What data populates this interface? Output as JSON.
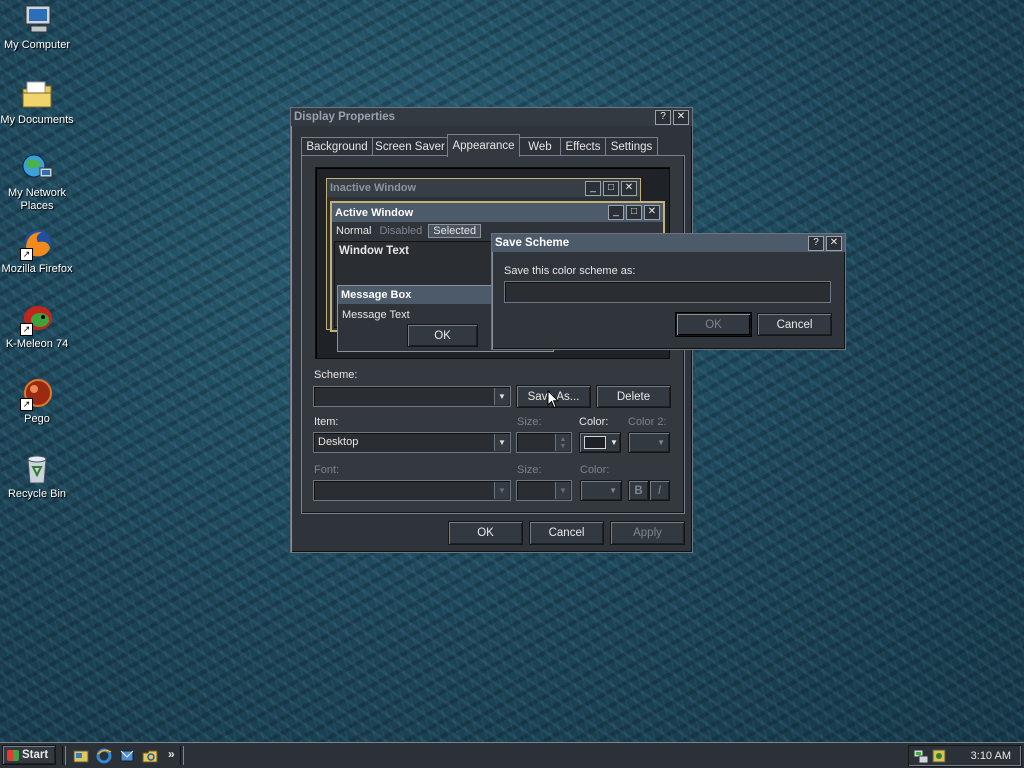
{
  "desktop_icons": [
    {
      "label": "My Computer",
      "icon": "computer-icon"
    },
    {
      "label": "My Documents",
      "icon": "folder-icon"
    },
    {
      "label": "My Network Places",
      "icon": "network-icon"
    },
    {
      "label": "Mozilla Firefox",
      "icon": "firefox-icon"
    },
    {
      "label": "K-Meleon 74",
      "icon": "kmeleon-icon"
    },
    {
      "label": "Pego",
      "icon": "pego-icon"
    },
    {
      "label": "Recycle Bin",
      "icon": "recycle-bin-icon"
    }
  ],
  "display_properties": {
    "title": "Display Properties",
    "tabs": [
      "Background",
      "Screen Saver",
      "Appearance",
      "Web",
      "Effects",
      "Settings"
    ],
    "active_tab": "Appearance",
    "preview": {
      "inactive_title": "Inactive Window",
      "active_title": "Active Window",
      "menu": [
        "Normal",
        "Disabled",
        "Selected"
      ],
      "window_text": "Window Text",
      "message_box_title": "Message Box",
      "message_text": "Message Text",
      "ok_label": "OK"
    },
    "scheme_label": "Scheme:",
    "scheme_value": "",
    "save_as_label": "Save As...",
    "delete_label": "Delete",
    "item_label": "Item:",
    "item_value": "Desktop",
    "size_label": "Size:",
    "color_label": "Color:",
    "color2_label": "Color 2:",
    "font_label": "Font:",
    "font_size_label": "Size:",
    "font_color_label": "Color:",
    "bold_label": "B",
    "italic_label": "I",
    "ok": "OK",
    "cancel": "Cancel",
    "apply": "Apply"
  },
  "save_scheme": {
    "title": "Save Scheme",
    "prompt": "Save this color scheme as:",
    "input_value": "",
    "ok": "OK",
    "cancel": "Cancel"
  },
  "taskbar": {
    "start_label": "Start",
    "quick_launch": [
      "show-desktop-icon",
      "ie-icon",
      "outlook-icon",
      "explorer-icon"
    ],
    "chevron": "»",
    "clock": "3:10 AM"
  },
  "colors": {
    "window_face": "#2f343b",
    "active_title_bg": "#4d5a6a",
    "preview_frame": "#c2b27a"
  }
}
